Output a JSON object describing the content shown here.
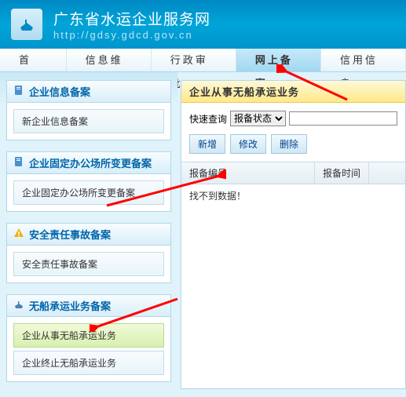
{
  "header": {
    "title": "广东省水运企业服务网",
    "url": "http://gdsy.gdcd.gov.cn"
  },
  "nav": [
    {
      "label": "首 页",
      "active": false
    },
    {
      "label": "信息维护",
      "active": false
    },
    {
      "label": "行政审批",
      "active": false
    },
    {
      "label": "网上备案",
      "active": true
    },
    {
      "label": "信用信息",
      "active": false
    }
  ],
  "sidebar": [
    {
      "title": "企业信息备案",
      "icon": "file",
      "items": [
        {
          "label": "新企业信息备案",
          "sel": false
        }
      ]
    },
    {
      "title": "企业固定办公场所变更备案",
      "icon": "file",
      "items": [
        {
          "label": "企业固定办公场所变更备案",
          "sel": false
        }
      ]
    },
    {
      "title": "安全责任事故备案",
      "icon": "warn",
      "items": [
        {
          "label": "安全责任事故备案",
          "sel": false
        }
      ]
    },
    {
      "title": "无船承运业务备案",
      "icon": "ship",
      "items": [
        {
          "label": "企业从事无船承运业务",
          "sel": true
        },
        {
          "label": "企业终止无船承运业务",
          "sel": false
        }
      ]
    }
  ],
  "main": {
    "title": "企业从事无船承运业务",
    "quick_label": "快速查询",
    "select_value": "报备状态",
    "input_value": "",
    "buttons": [
      "新增",
      "修改",
      "删除"
    ],
    "columns": [
      "报备编号",
      "报备时间"
    ],
    "empty": "找不到数据！"
  }
}
